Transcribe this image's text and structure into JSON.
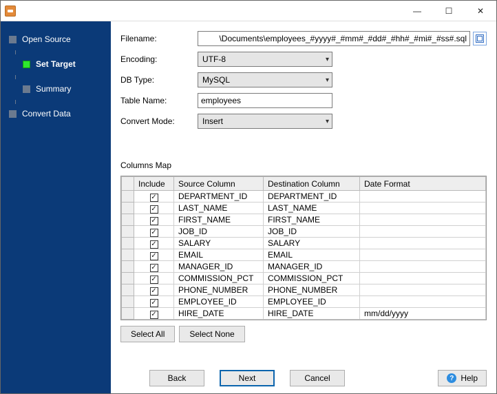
{
  "titlebar": {
    "minimize": "—",
    "maximize": "☐",
    "close": "✕"
  },
  "sidebar": {
    "steps": [
      {
        "label": "Open Source",
        "current": false,
        "sub": false
      },
      {
        "label": "Set Target",
        "current": true,
        "sub": true
      },
      {
        "label": "Summary",
        "current": false,
        "sub": true
      },
      {
        "label": "Convert Data",
        "current": false,
        "sub": false
      }
    ]
  },
  "form": {
    "filename_label": "Filename:",
    "filename_value": "\\Documents\\employees_#yyyy#_#mm#_#dd#_#hh#_#mi#_#ss#.sql",
    "encoding_label": "Encoding:",
    "encoding_value": "UTF-8",
    "dbtype_label": "DB Type:",
    "dbtype_value": "MySQL",
    "tablename_label": "Table Name:",
    "tablename_value": "employees",
    "convertmode_label": "Convert Mode:",
    "convertmode_value": "Insert"
  },
  "columns_map": {
    "title": "Columns Map",
    "headers": {
      "include": "Include",
      "source": "Source Column",
      "destination": "Destination Column",
      "dateformat": "Date Format"
    },
    "rows": [
      {
        "include": true,
        "source": "DEPARTMENT_ID",
        "destination": "DEPARTMENT_ID",
        "dateformat": ""
      },
      {
        "include": true,
        "source": "LAST_NAME",
        "destination": "LAST_NAME",
        "dateformat": ""
      },
      {
        "include": true,
        "source": "FIRST_NAME",
        "destination": "FIRST_NAME",
        "dateformat": ""
      },
      {
        "include": true,
        "source": "JOB_ID",
        "destination": "JOB_ID",
        "dateformat": ""
      },
      {
        "include": true,
        "source": "SALARY",
        "destination": "SALARY",
        "dateformat": ""
      },
      {
        "include": true,
        "source": "EMAIL",
        "destination": "EMAIL",
        "dateformat": ""
      },
      {
        "include": true,
        "source": "MANAGER_ID",
        "destination": "MANAGER_ID",
        "dateformat": ""
      },
      {
        "include": true,
        "source": "COMMISSION_PCT",
        "destination": "COMMISSION_PCT",
        "dateformat": ""
      },
      {
        "include": true,
        "source": "PHONE_NUMBER",
        "destination": "PHONE_NUMBER",
        "dateformat": ""
      },
      {
        "include": true,
        "source": "EMPLOYEE_ID",
        "destination": "EMPLOYEE_ID",
        "dateformat": ""
      },
      {
        "include": true,
        "source": "HIRE_DATE",
        "destination": "HIRE_DATE",
        "dateformat": "mm/dd/yyyy"
      }
    ],
    "select_all": "Select All",
    "select_none": "Select None"
  },
  "footer": {
    "back": "Back",
    "next": "Next",
    "cancel": "Cancel",
    "help": "Help"
  }
}
